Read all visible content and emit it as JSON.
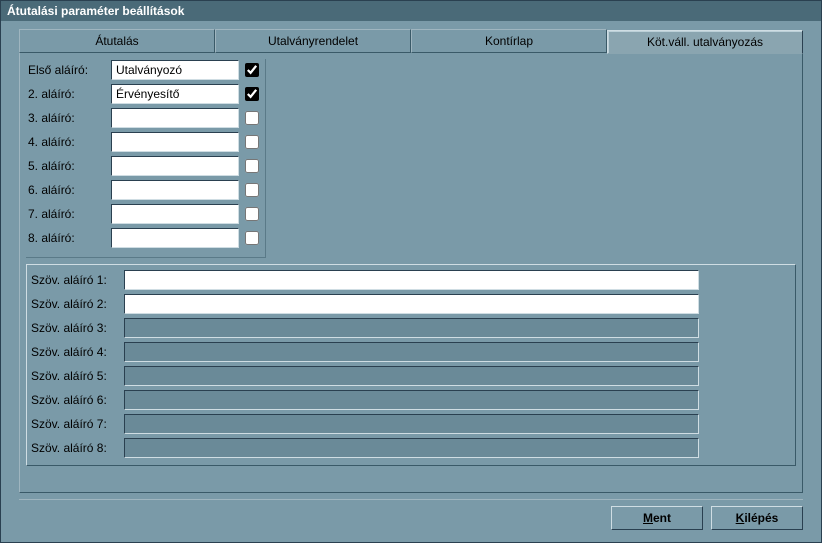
{
  "title": "Átutalási paraméter beállítások",
  "tabs": {
    "t0": "Átutalás",
    "t1": "Utalványrendelet",
    "t2": "Kontírlap",
    "t3": "Köt.váll. utalványozás"
  },
  "signers": {
    "labels": {
      "s1": "Első aláíró:",
      "s2": "2. aláíró:",
      "s3": "3. aláíró:",
      "s4": "4. aláíró:",
      "s5": "5. aláíró:",
      "s6": "6. aláíró:",
      "s7": "7. aláíró:",
      "s8": "8. aláíró:"
    },
    "values": {
      "s1": "Utalványozó",
      "s2": "Érvényesítő",
      "s3": "",
      "s4": "",
      "s5": "",
      "s6": "",
      "s7": "",
      "s8": ""
    },
    "checked": {
      "s1": true,
      "s2": true,
      "s3": false,
      "s4": false,
      "s5": false,
      "s6": false,
      "s7": false,
      "s8": false
    }
  },
  "textsigners": {
    "labels": {
      "t1": "Szöv. aláíró 1:",
      "t2": "Szöv. aláíró 2:",
      "t3": "Szöv. aláíró 3:",
      "t4": "Szöv. aláíró 4:",
      "t5": "Szöv. aláíró 5:",
      "t6": "Szöv. aláíró 6:",
      "t7": "Szöv. aláíró 7:",
      "t8": "Szöv. aláíró 8:"
    },
    "values": {
      "t1": "",
      "t2": "",
      "t3": "",
      "t4": "",
      "t5": "",
      "t6": "",
      "t7": "",
      "t8": ""
    },
    "enabled": {
      "t1": true,
      "t2": true,
      "t3": false,
      "t4": false,
      "t5": false,
      "t6": false,
      "t7": false,
      "t8": false
    }
  },
  "buttons": {
    "save_label": "Ment",
    "save_hotkey": "M",
    "exit_label": "Kilépés",
    "exit_hotkey": "K"
  }
}
